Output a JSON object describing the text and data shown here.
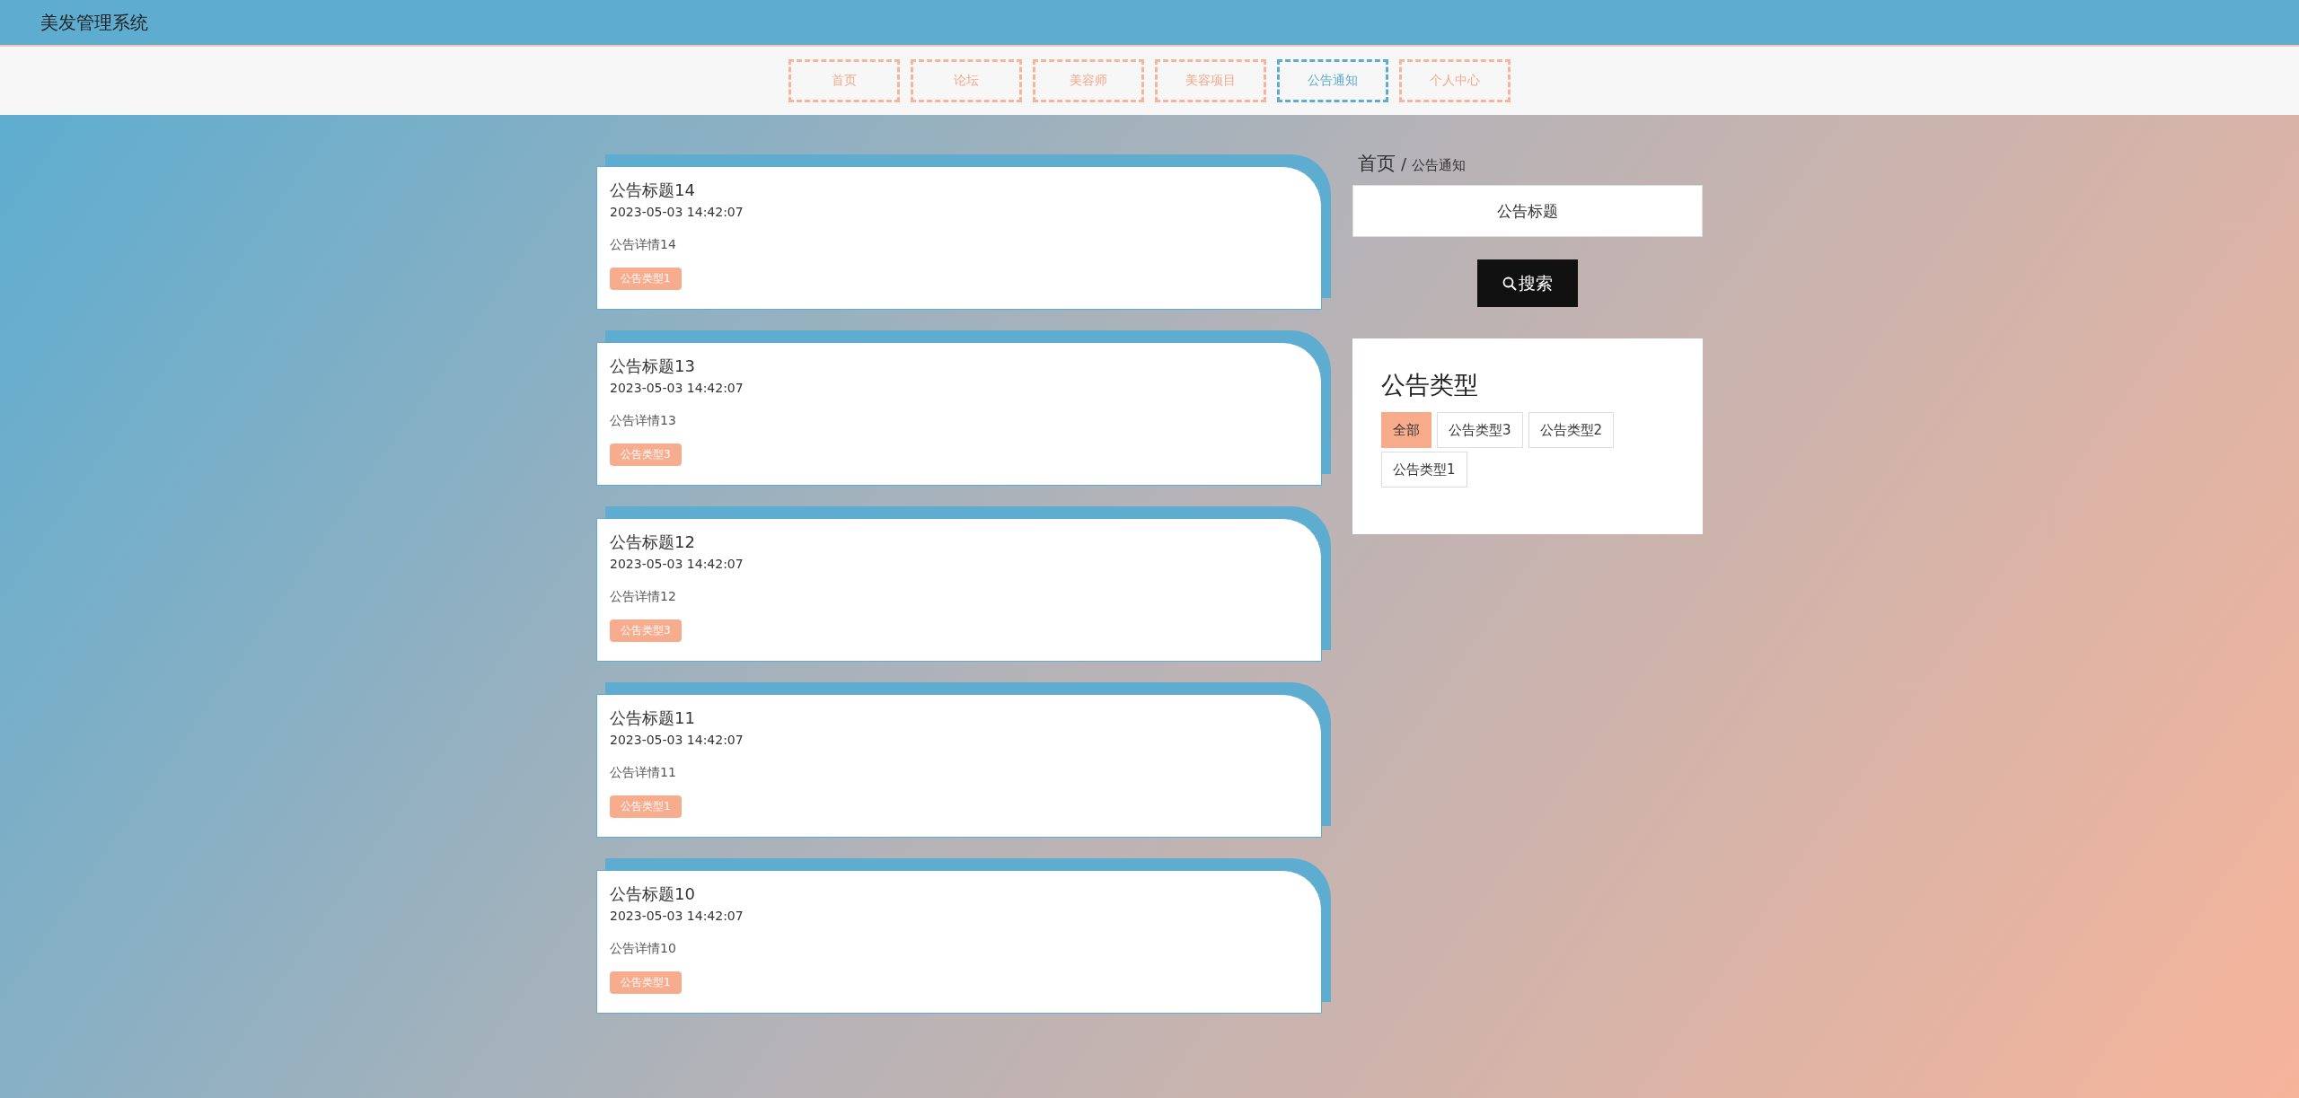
{
  "header": {
    "title": "美发管理系统"
  },
  "nav": [
    {
      "label": "首页",
      "selected": false
    },
    {
      "label": "论坛",
      "selected": false
    },
    {
      "label": "美容师",
      "selected": false
    },
    {
      "label": "美容项目",
      "selected": false
    },
    {
      "label": "公告通知",
      "selected": true
    },
    {
      "label": "个人中心",
      "selected": false
    }
  ],
  "notices": [
    {
      "title": "公告标题14",
      "time": "2023-05-03 14:42:07",
      "detail": "公告详情14",
      "type": "公告类型1"
    },
    {
      "title": "公告标题13",
      "time": "2023-05-03 14:42:07",
      "detail": "公告详情13",
      "type": "公告类型3"
    },
    {
      "title": "公告标题12",
      "time": "2023-05-03 14:42:07",
      "detail": "公告详情12",
      "type": "公告类型3"
    },
    {
      "title": "公告标题11",
      "time": "2023-05-03 14:42:07",
      "detail": "公告详情11",
      "type": "公告类型1"
    },
    {
      "title": "公告标题10",
      "time": "2023-05-03 14:42:07",
      "detail": "公告详情10",
      "type": "公告类型1"
    }
  ],
  "breadcrumb": {
    "items": [
      "首页",
      "公告通知"
    ],
    "separator": "/"
  },
  "search": {
    "placeholder": "公告标题",
    "button": "搜索"
  },
  "types_panel": {
    "title": "公告类型",
    "items": [
      {
        "label": "全部",
        "selected": true
      },
      {
        "label": "公告类型3",
        "selected": false
      },
      {
        "label": "公告类型2",
        "selected": false
      },
      {
        "label": "公告类型1",
        "selected": false
      }
    ]
  }
}
